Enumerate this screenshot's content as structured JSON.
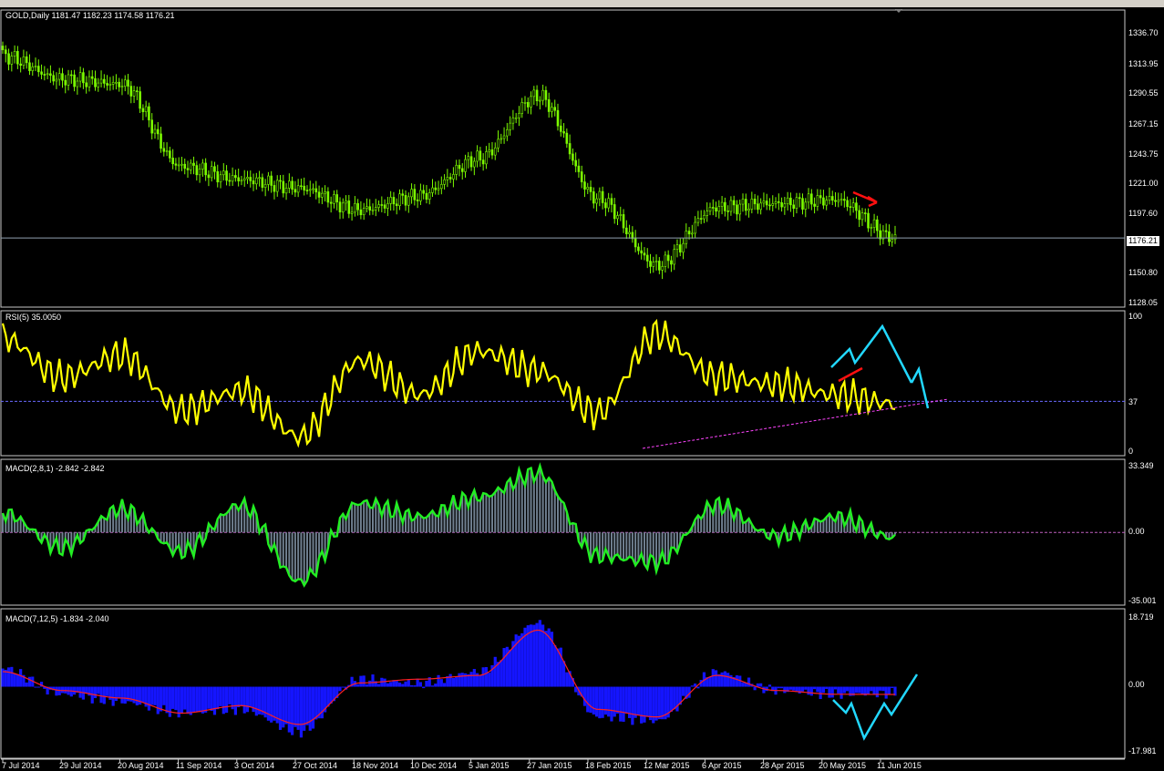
{
  "header": {
    "symbol_tf": "GOLD,Daily",
    "ohlc": "1181.47 1182.23 1174.58 1176.21"
  },
  "panes": {
    "price": {
      "label": "GOLD,Daily  1181.47 1182.23 1174.58 1176.21",
      "ticks": [
        "1336.70",
        "1313.95",
        "1290.55",
        "1267.15",
        "1243.75",
        "1221.00",
        "1197.60",
        "1176.21",
        "1150.80",
        "1128.05"
      ],
      "current_price": "1176.21"
    },
    "rsi": {
      "label": "RSI(5) 35.0050",
      "ticks": [
        "100",
        "37",
        "0"
      ]
    },
    "macd1": {
      "label": "MACD(2,8,1) -2.842 -2.842",
      "ticks": [
        "33.349",
        "0.00",
        "-35.001"
      ]
    },
    "macd2": {
      "label": "MACD(7,12,5) -1.834 -2.040",
      "ticks": [
        "18.719",
        "0.00",
        "-17.981"
      ]
    }
  },
  "x_axis": {
    "dates": [
      "7 Jul 2014",
      "29 Jul 2014",
      "20 Aug 2014",
      "11 Sep 2014",
      "3 Oct 2014",
      "27 Oct 2014",
      "18 Nov 2014",
      "10 Dec 2014",
      "5 Jan 2015",
      "27 Jan 2015",
      "18 Feb 2015",
      "12 Mar 2015",
      "6 Apr 2015",
      "28 Apr 2015",
      "20 May 2015",
      "11 Jun 2015"
    ]
  },
  "colors": {
    "candle": "#7cfc00",
    "rsi": "#ffff00",
    "macd1_line": "#22ee22",
    "macd1_hist": "#708090",
    "macd2_hist": "#1515ff",
    "macd2_signal": "#ff2020",
    "annotation_cyan": "#22d8ff",
    "annotation_red": "#ff1010",
    "trendline": "#ff44ff"
  },
  "chart_data": [
    {
      "type": "candlestick",
      "title": "GOLD,Daily",
      "x": [
        "7 Jul 2014",
        "29 Jul 2014",
        "20 Aug 2014",
        "11 Sep 2014",
        "3 Oct 2014",
        "27 Oct 2014",
        "18 Nov 2014",
        "10 Dec 2014",
        "5 Jan 2015",
        "27 Jan 2015",
        "18 Feb 2015",
        "12 Mar 2015",
        "6 Apr 2015",
        "28 Apr 2015",
        "20 May 2015",
        "11 Jun 2015"
      ],
      "close": [
        1318,
        1300,
        1296,
        1232,
        1222,
        1215,
        1198,
        1209,
        1238,
        1287,
        1207,
        1155,
        1200,
        1203,
        1206,
        1176
      ],
      "ylim": [
        1128.05,
        1336.7
      ]
    },
    {
      "type": "line",
      "title": "RSI(5) 35.0050",
      "x": [
        "7 Jul 2014",
        "29 Jul 2014",
        "20 Aug 2014",
        "11 Sep 2014",
        "3 Oct 2014",
        "27 Oct 2014",
        "18 Nov 2014",
        "10 Dec 2014",
        "5 Jan 2015",
        "27 Jan 2015",
        "18 Feb 2015",
        "12 Mar 2015",
        "6 Apr 2015",
        "28 Apr 2015",
        "20 May 2015",
        "11 Jun 2015"
      ],
      "values": [
        85,
        55,
        72,
        30,
        45,
        10,
        68,
        42,
        75,
        60,
        28,
        88,
        55,
        50,
        42,
        35
      ],
      "ylim": [
        0,
        100
      ],
      "level": 37
    },
    {
      "type": "bar",
      "title": "MACD(2,8,1) -2.842 -2.842",
      "x": [
        "7 Jul 2014",
        "29 Jul 2014",
        "20 Aug 2014",
        "11 Sep 2014",
        "3 Oct 2014",
        "27 Oct 2014",
        "18 Nov 2014",
        "10 Dec 2014",
        "5 Jan 2015",
        "27 Jan 2015",
        "18 Feb 2015",
        "12 Mar 2015",
        "6 Apr 2015",
        "28 Apr 2015",
        "20 May 2015",
        "11 Jun 2015"
      ],
      "values": [
        10,
        -8,
        12,
        -10,
        14,
        -25,
        15,
        8,
        18,
        30,
        -12,
        -15,
        14,
        -2,
        8,
        -2.842
      ],
      "ylim": [
        -35.001,
        33.349
      ]
    },
    {
      "type": "bar",
      "title": "MACD(7,12,5) -1.834 -2.040",
      "x": [
        "7 Jul 2014",
        "29 Jul 2014",
        "20 Aug 2014",
        "11 Sep 2014",
        "3 Oct 2014",
        "27 Oct 2014",
        "18 Nov 2014",
        "10 Dec 2014",
        "5 Jan 2015",
        "27 Jan 2015",
        "18 Feb 2015",
        "12 Mar 2015",
        "6 Apr 2015",
        "28 Apr 2015",
        "20 May 2015",
        "11 Jun 2015"
      ],
      "values": [
        5,
        -2,
        -4,
        -7,
        -6,
        -12,
        2,
        1,
        4,
        17,
        -8,
        -9,
        4,
        -1,
        -2,
        -1.834
      ],
      "signal": [
        4,
        -1,
        -3,
        -7,
        -5,
        -10,
        1,
        2,
        3,
        15,
        -6,
        -8,
        3,
        -1,
        -2,
        -2.04
      ],
      "ylim": [
        -17.981,
        18.719
      ]
    }
  ]
}
